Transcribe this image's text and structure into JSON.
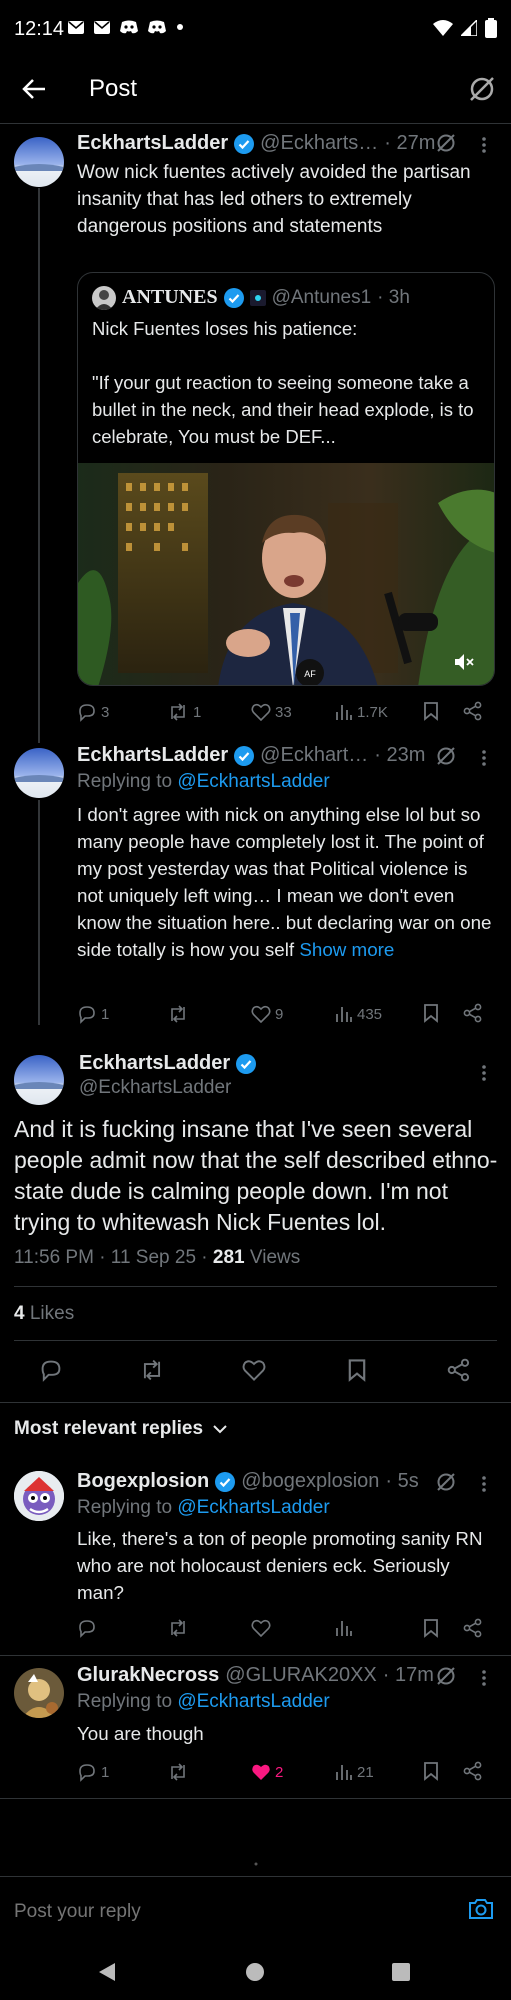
{
  "status_bar": {
    "time": "12:14"
  },
  "header": {
    "title": "Post"
  },
  "post1": {
    "name": "EckhartsLadder",
    "handle": "@Eckharts…",
    "time": "· 27m",
    "text": "Wow nick fuentes actively avoided the partisan insanity that has led others to extremely dangerous positions and statements",
    "quote": {
      "name": "ANTUNES",
      "handle": "@Antunes1",
      "time": "· 3h",
      "text_line1": "Nick Fuentes loses his patience:",
      "text_rest": "\"If your gut reaction to seeing someone take a bullet in the neck, and their head explode, is to celebrate, You must be DEF..."
    },
    "replies": "3",
    "reposts": "1",
    "likes": "33",
    "views": "1.7K"
  },
  "post2": {
    "name": "EckhartsLadder",
    "handle": "@Eckhart…",
    "time": "· 23m",
    "replying_prefix": "Replying to",
    "replying_to": "@EckhartsLadder",
    "text": "I don't agree with nick on anything else lol but so many people have completely lost it. The point of my post yesterday was that Political violence is not uniquely left wing… I mean we don't even know the situation here.. but declaring war on one side totally is how you self",
    "show_more": "Show more",
    "replies": "1",
    "likes": "9",
    "views": "435"
  },
  "main_post": {
    "name": "EckhartsLadder",
    "handle": "@EckhartsLadder",
    "text": "And it is fucking insane that I've seen several people admit now that the self described ethno-state dude is calming people down. I'm not trying to whitewash Nick Fuentes lol.",
    "timestamp": "11:56 PM · 11 Sep 25 · ",
    "views_count": "281",
    "views_label": " Views",
    "likes_count": "4",
    "likes_label": " Likes"
  },
  "replies_header": {
    "label": "Most relevant replies"
  },
  "reply1": {
    "name": "Bogexplosion",
    "handle": "@bogexplosion",
    "time": "· 5s",
    "replying_prefix": "Replying to",
    "replying_to": "@EckhartsLadder",
    "text": "Like, there's a ton of people promoting sanity RN who are not holocaust deniers eck. Seriously man?"
  },
  "reply2": {
    "name": "GlurakNecross",
    "handle": "@GLURAK20XX",
    "time": "· 17m",
    "replying_prefix": "Replying to",
    "replying_to": "@EckhartsLadder",
    "text": "You are though",
    "replies": "1",
    "likes": "2",
    "views": "21"
  },
  "reply_bar": {
    "placeholder": "Post your reply"
  },
  "colors": {
    "accent": "#1d9bf0",
    "like": "#f91880",
    "background": "#000000"
  }
}
